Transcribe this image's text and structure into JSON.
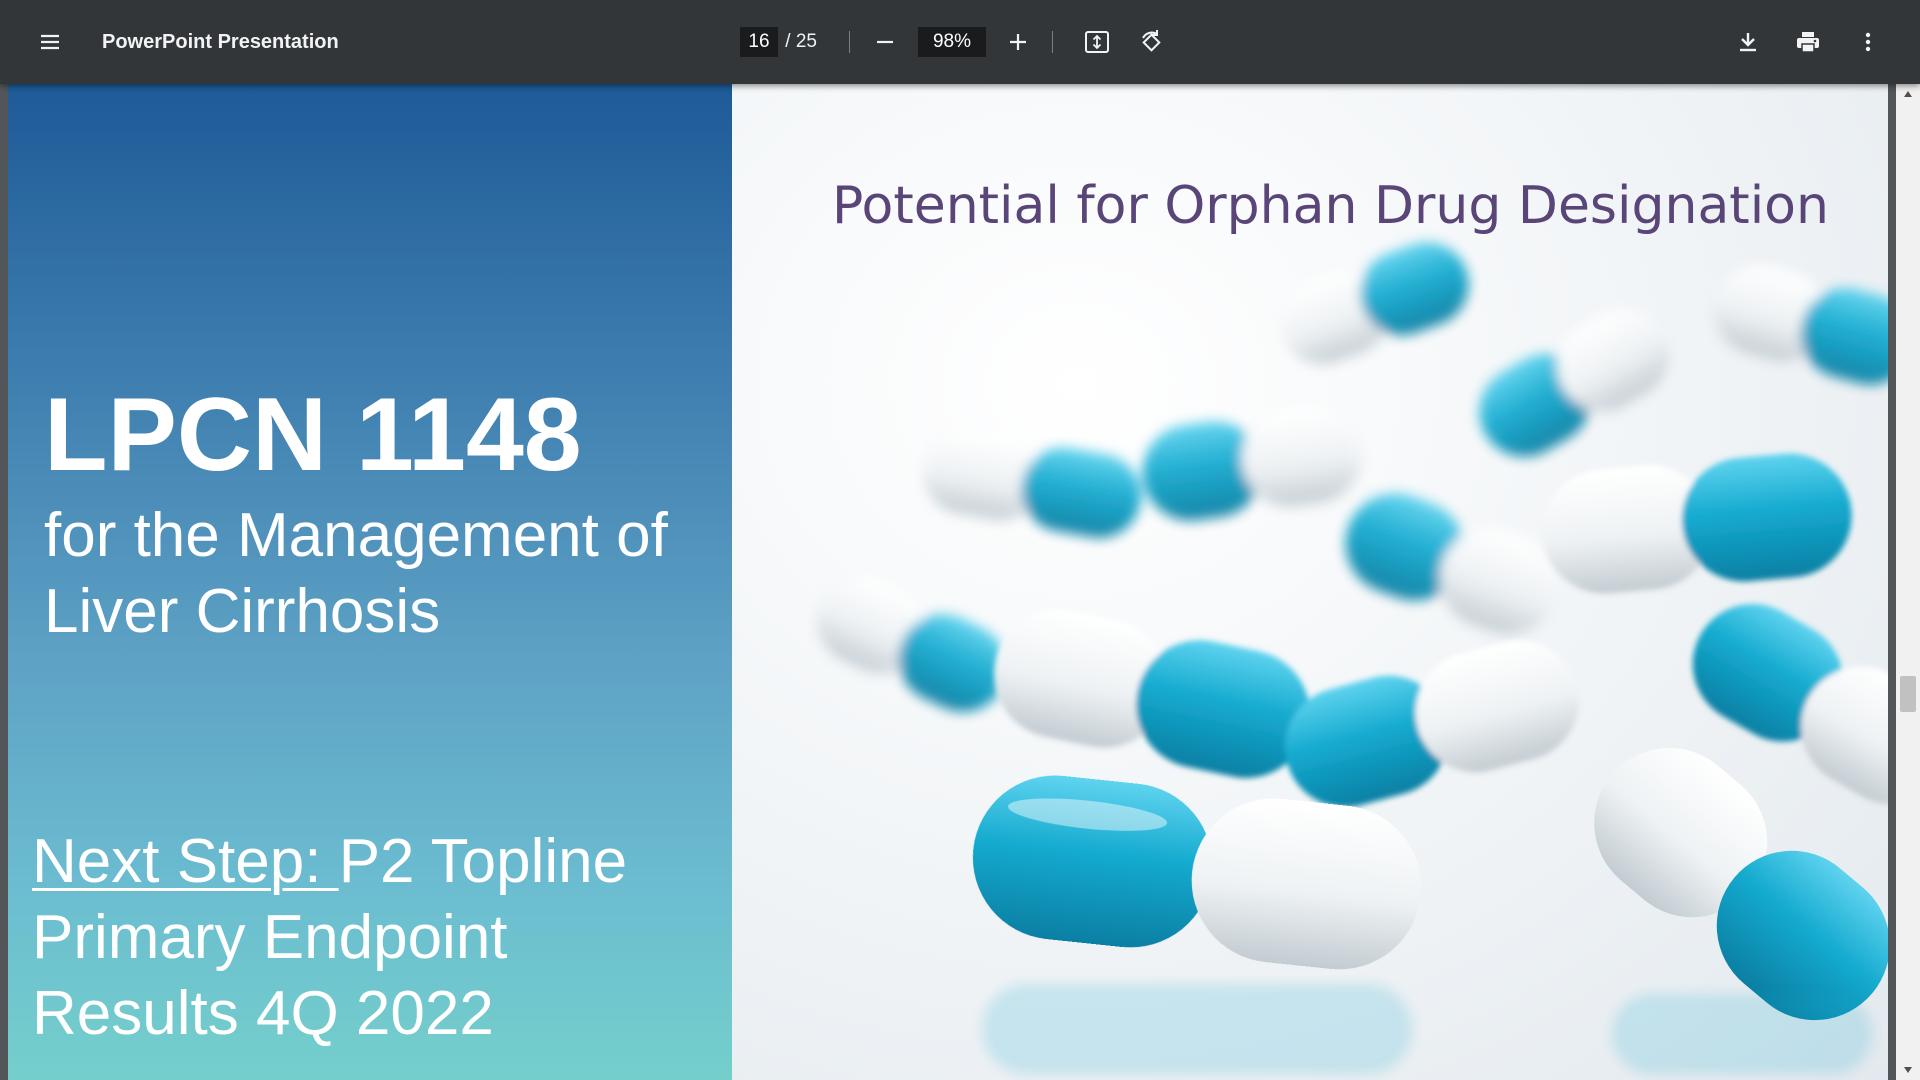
{
  "toolbar": {
    "title": "PowerPoint Presentation",
    "page_current": "16",
    "page_separator": " / ",
    "page_total": "25",
    "zoom": "98%",
    "icons": {
      "menu": "hamburger-menu-icon",
      "zoom_out": "minus-icon",
      "zoom_in": "plus-icon",
      "fit": "fit-page-icon",
      "rotate": "rotate-counterclockwise-icon",
      "download": "download-icon",
      "print": "print-icon",
      "more": "more-vertical-icon"
    }
  },
  "slide": {
    "left": {
      "title": "LPCN 1148",
      "subtitle_line1": "for the Management of",
      "subtitle_line2": "Liver Cirrhosis",
      "next_step_label": "Next Step: ",
      "next_step_text1": "P2 Topline",
      "next_step_text2": "Primary Endpoint",
      "next_step_text3": "Results 4Q 2022"
    },
    "right": {
      "heading": "Potential for Orphan Drug Designation",
      "image": "blue-white-capsules-photo"
    }
  },
  "colors": {
    "toolbar_bg": "#323639",
    "viewer_bg": "#525659",
    "heading_purple": "#5a4578",
    "capsule_blue": "#14aacf",
    "gradient_top": "#1e5a97",
    "gradient_bottom": "#74cfcb"
  }
}
